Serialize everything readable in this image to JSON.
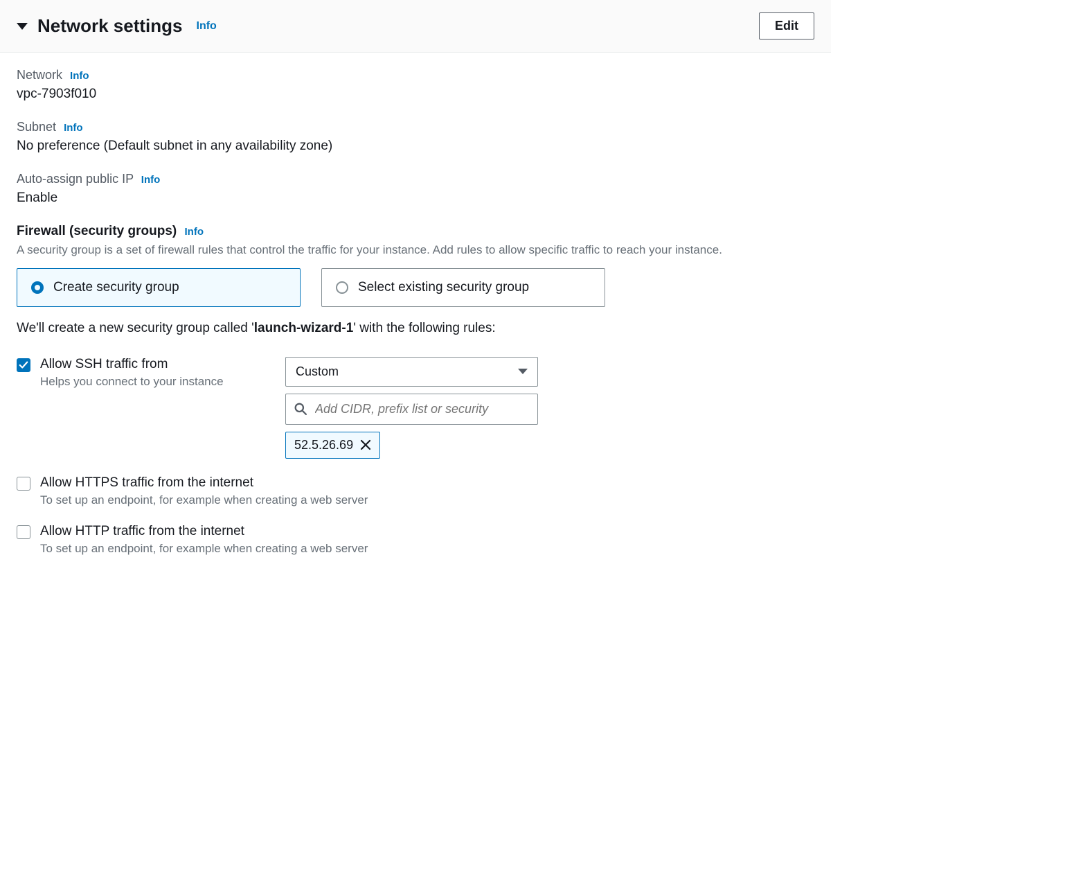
{
  "header": {
    "title": "Network settings",
    "info": "Info",
    "edit": "Edit"
  },
  "network": {
    "label": "Network",
    "info": "Info",
    "value": "vpc-7903f010"
  },
  "subnet": {
    "label": "Subnet",
    "info": "Info",
    "value": "No preference (Default subnet in any availability zone)"
  },
  "publicIp": {
    "label": "Auto-assign public IP",
    "info": "Info",
    "value": "Enable"
  },
  "firewall": {
    "label": "Firewall (security groups)",
    "info": "Info",
    "desc": "A security group is a set of firewall rules that control the traffic for your instance. Add rules to allow specific traffic to reach your instance.",
    "optionCreate": "Create security group",
    "optionSelect": "Select existing security group",
    "sentencePrefix": "We'll create a new security group called '",
    "sentenceName": "launch-wizard-1",
    "sentenceSuffix": "' with the following rules:"
  },
  "ssh": {
    "title": "Allow SSH traffic from",
    "desc": "Helps you connect to your instance",
    "selectValue": "Custom",
    "searchPlaceholder": "Add CIDR, prefix list or security",
    "tag": "52.5.26.69"
  },
  "https": {
    "title": "Allow HTTPS traffic from the internet",
    "desc": "To set up an endpoint, for example when creating a web server"
  },
  "http": {
    "title": "Allow HTTP traffic from the internet",
    "desc": "To set up an endpoint, for example when creating a web server"
  }
}
